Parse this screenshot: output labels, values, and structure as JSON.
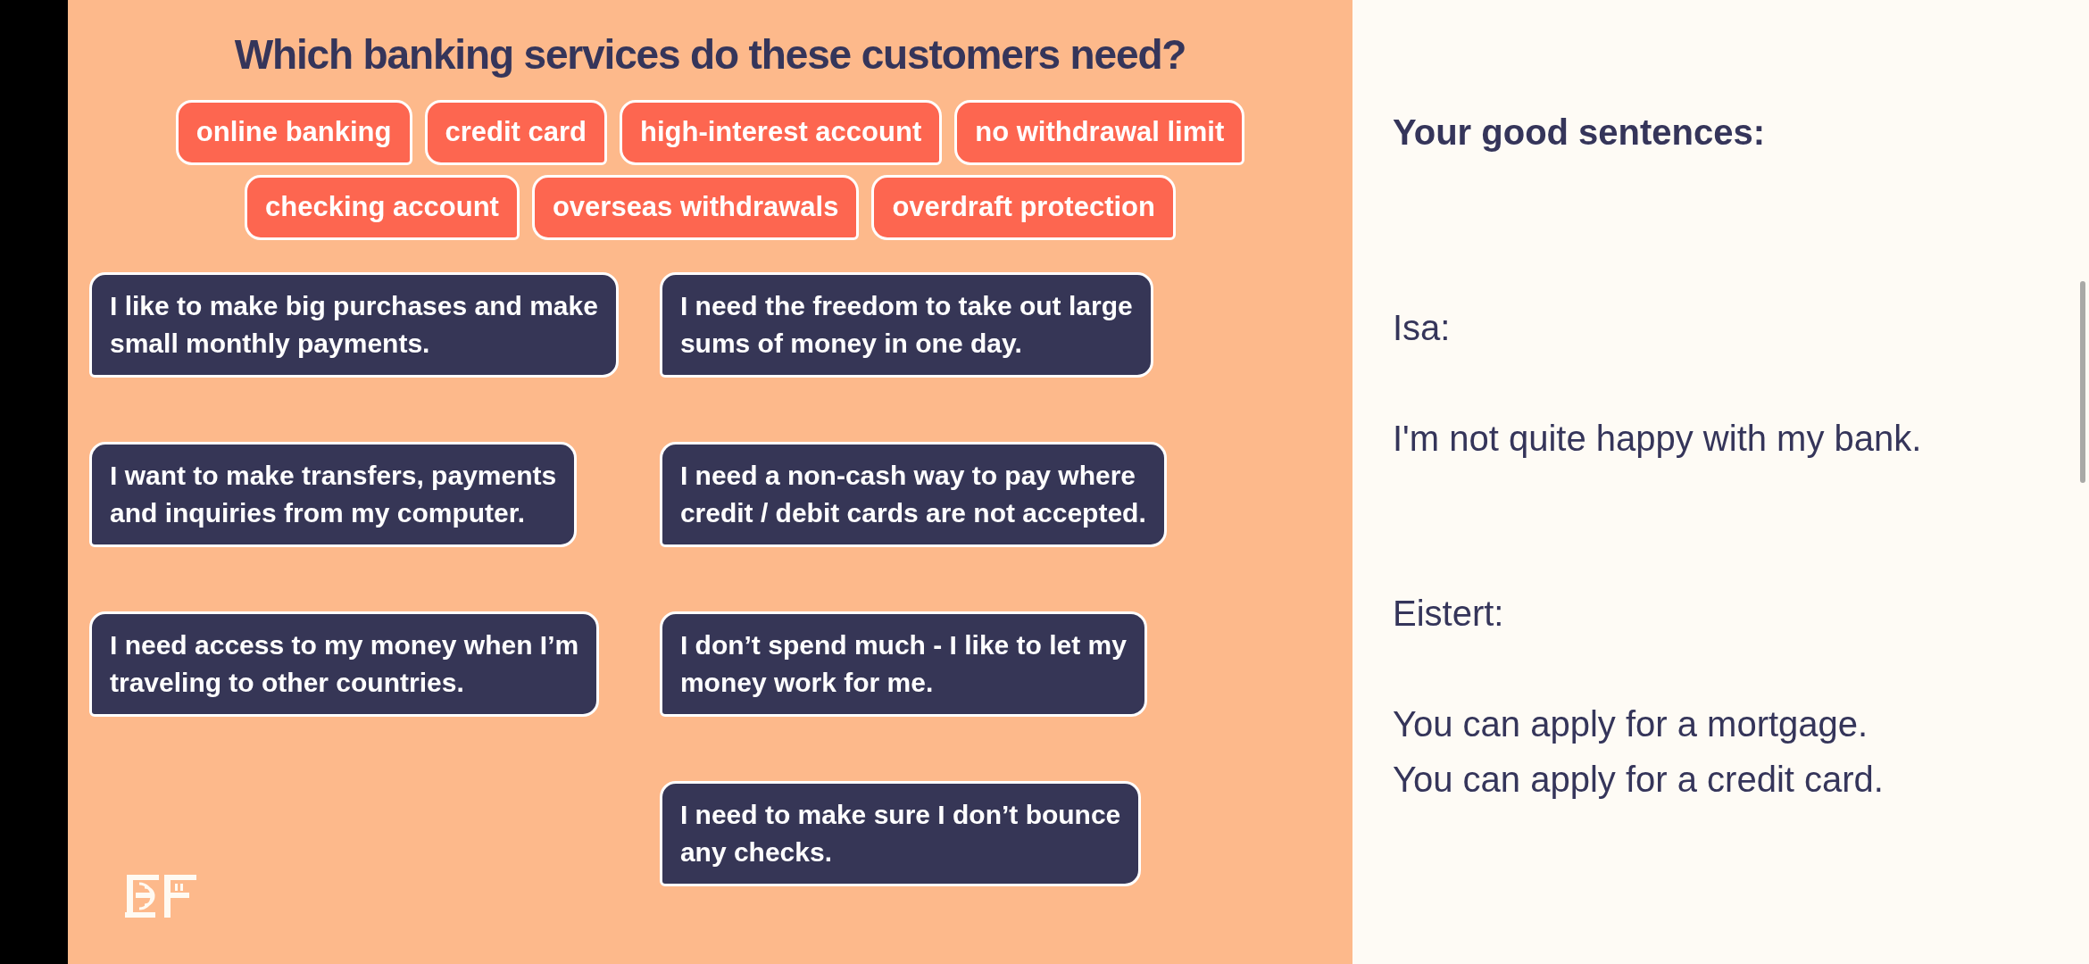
{
  "slide": {
    "title": "Which banking services do these customers need?",
    "service_rows": [
      [
        "online banking",
        "credit card",
        "high-interest account",
        "no withdrawal limit"
      ],
      [
        "checking account",
        "overseas withdrawals",
        "overdraft protection"
      ]
    ],
    "need_columns": [
      [
        {
          "lines": [
            "I like to make big purchases and make",
            "small monthly payments."
          ]
        },
        {
          "lines": [
            "I want to make transfers, payments",
            "and inquiries from my computer."
          ]
        },
        {
          "lines": [
            "I need access to my money when I’m",
            "traveling to other countries."
          ]
        }
      ],
      [
        {
          "lines": [
            "I need the freedom to take out large",
            "sums of money in one day."
          ]
        },
        {
          "lines": [
            "I need a non-cash way to pay where",
            "credit / debit cards are not accepted."
          ]
        },
        {
          "lines": [
            "I don’t spend much - I like to let my",
            "money work for me."
          ]
        },
        {
          "lines": [
            "I need to make sure I don’t bounce",
            "any checks."
          ]
        }
      ]
    ]
  },
  "panel": {
    "heading": "Your good sentences:",
    "entries": [
      {
        "name": "Isa:",
        "lines": [
          "I'm not quite happy with my bank."
        ]
      },
      {
        "name": "Eistert:",
        "lines": [
          "You can apply for a mortgage.",
          "You can apply for a credit card."
        ]
      }
    ]
  }
}
